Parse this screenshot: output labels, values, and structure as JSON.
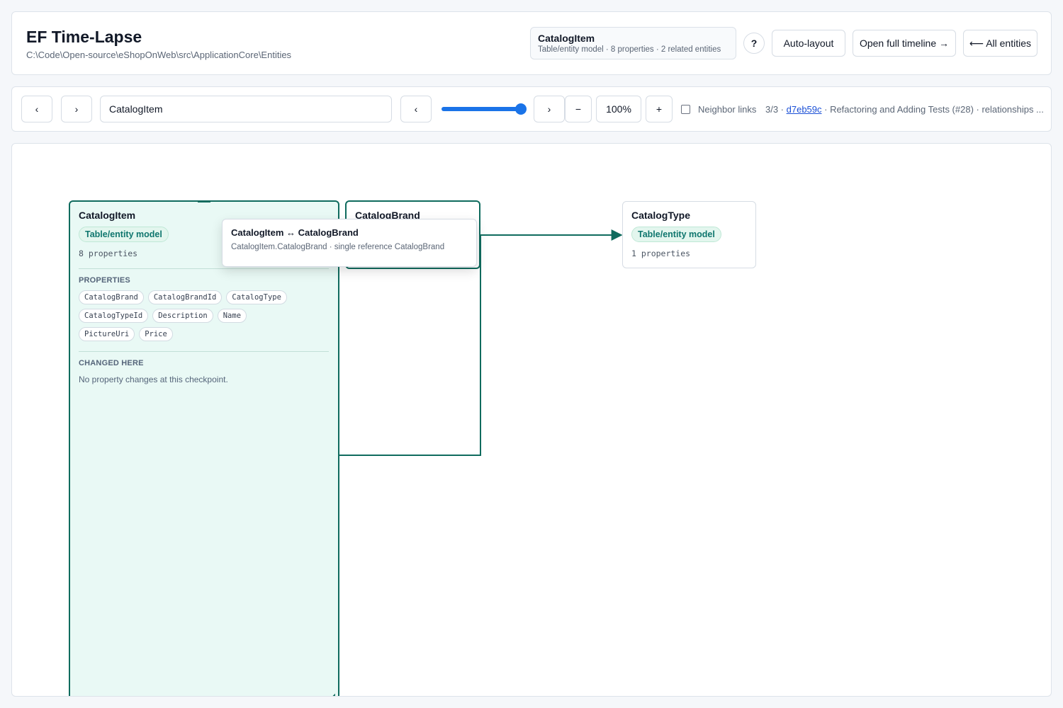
{
  "header": {
    "title": "EF Time-Lapse",
    "path": "C:\\Code\\Open-source\\eShopOnWeb\\src\\ApplicationCore\\Entities",
    "summary": {
      "title": "CatalogItem",
      "subtitle": "Table/entity model · 8 properties · 2 related entities"
    },
    "help_label": "?",
    "auto_layout_label": "Auto-layout",
    "open_timeline_label": "Open full timeline →",
    "all_entities_label": "⟵ All entities"
  },
  "toolbar": {
    "prev_entity_label": "‹",
    "next_entity_label": "›",
    "search_value": "CatalogItem",
    "prev_checkpoint_label": "‹",
    "next_checkpoint_label": "›",
    "timeline_position": 1.0,
    "zoom_out_label": "−",
    "zoom_level": "100%",
    "zoom_in_label": "+",
    "neighbor_links_label": "Neighbor links",
    "neighbor_links_checked": false,
    "checkpoint": {
      "position": "3/3 · ",
      "commit": "d7eb59c",
      "message": " · Refactoring and Adding Tests (#28) · relationships ..."
    }
  },
  "canvas": {
    "nodes": {
      "catalogitem": {
        "name": "CatalogItem",
        "badge": "Table/entity model",
        "count": "8 properties",
        "properties_heading": "PROPERTIES",
        "properties": [
          "CatalogBrand",
          "CatalogBrandId",
          "CatalogType",
          "CatalogTypeId",
          "Description",
          "Name",
          "PictureUri",
          "Price"
        ],
        "changes_heading": "CHANGED HERE",
        "changes_text": "No property changes at this checkpoint."
      },
      "catalogbrand": {
        "name": "CatalogBrand"
      },
      "catalogtype": {
        "name": "CatalogType",
        "badge": "Table/entity model",
        "count": "1 properties"
      }
    },
    "tooltip": {
      "title": "CatalogItem ↔ CatalogBrand",
      "detail": "CatalogItem.CatalogBrand · single reference CatalogBrand"
    },
    "edge_color": "#0f6b5e"
  }
}
